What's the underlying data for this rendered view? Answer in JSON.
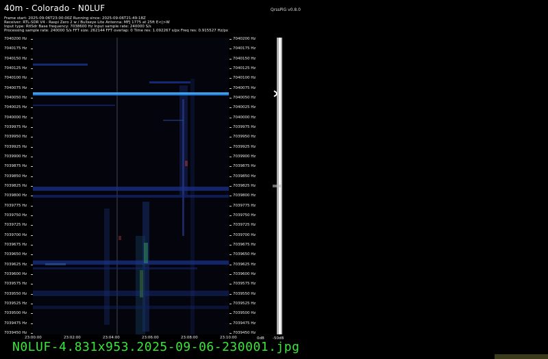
{
  "header": {
    "title": "40m - Colorado - N0LUF",
    "version": "QrssPiG v0.8.0",
    "info_lines": [
      "Frame start: 2025-09-06T23:00:00Z Running since: 2025-09-06T21:49:18Z",
      "Receiver: RTL-SDR V4 - Raspi Zero 2 w / Bullseye Lite Antenna: MFJ 1775 at 25ft E<|>W",
      "Input type: RtlSdr Base frequency: 7038600 Hz Input sample rate: 240000 S/s",
      "Processing sample rate: 240000 S/s FFT size: 262144 FFT overlap: 0 Time res: 1.092267 s/px Freq res: 0.915527 Hz/px"
    ]
  },
  "frequency_labels": [
    "7040200 Hz",
    "7040175 Hz",
    "7040150 Hz",
    "7040125 Hz",
    "7040100 Hz",
    "7040075 Hz",
    "7040050 Hz",
    "7040025 Hz",
    "7040000 Hz",
    "7039975 Hz",
    "7039950 Hz",
    "7039925 Hz",
    "7039900 Hz",
    "7039875 Hz",
    "7039850 Hz",
    "7039825 Hz",
    "7039800 Hz",
    "7039775 Hz",
    "7039750 Hz",
    "7039725 Hz",
    "7039700 Hz",
    "7039675 Hz",
    "7039650 Hz",
    "7039625 Hz",
    "7039600 Hz",
    "7039575 Hz",
    "7039550 Hz",
    "7039525 Hz",
    "7039500 Hz",
    "7039475 Hz",
    "7039450 Hz"
  ],
  "time_labels": [
    "23:00:00",
    "23:02:00",
    "23:04:00",
    "23:06:00",
    "23:08:00",
    "23:10:00"
  ],
  "db_labels": [
    "0dB",
    "-50dB"
  ],
  "filename": "N0LUF-4.831x953.2025-09-06-230001.jpg",
  "colors": {
    "signal": "#3fb0ff",
    "filename": "#39e639"
  }
}
